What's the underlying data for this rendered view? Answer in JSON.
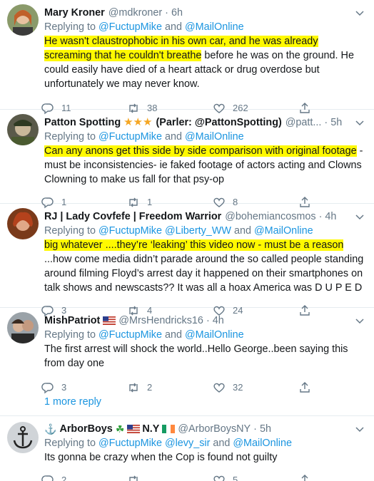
{
  "tweets": [
    {
      "name": "Mary Kroner",
      "handle": "@mdkroner",
      "time": "6h",
      "replying_prefix": "Replying to ",
      "replying_link_1": "@FuctupMike",
      "replying_and": " and ",
      "replying_link_2": "@MailOnline",
      "text_hl": "He wasn't claustrophobic in his own car, and he was already screaming that he couldn't breathe",
      "text_rest": " before he was on the ground. He could easily have died of a heart attack or drug overdose but unfortunately we may never know.",
      "replies": "11",
      "retweets": "38",
      "likes": "262"
    },
    {
      "name": "Patton Spotting",
      "name_suffix": "(Parler: @PattonSpotting)",
      "handle": "@patt...",
      "time": "5h",
      "replying_prefix": "Replying to ",
      "replying_link_1": "@FuctupMike",
      "replying_and": " and ",
      "replying_link_2": "@MailOnline",
      "text_hl": "Can any anons get this side by side comparison with original footage",
      "text_rest": " - must be inconsistencies- ie faked footage of actors acting and Clowns Clowning to make us fall for that psy-op",
      "replies": "1",
      "retweets": "1",
      "likes": "8"
    },
    {
      "name": "RJ | Lady Covfefe | Freedom Warrior",
      "handle": "@bohemiancosmos",
      "time": "4h",
      "replying_prefix": "Replying to ",
      "replying_link_1": "@FuctupMike",
      "replying_link_2": "@Liberty_WW",
      "replying_and": " and ",
      "replying_link_3": "@MailOnline",
      "text_hl": "big whatever ....they’re ‘leaking’ this video now - must be a reason",
      "text_rest": " ...how come media didn’t parade around the so called people standing around filming Floyd’s arrest day it happened on their smartphones on talk shows and newscasts??  It was all a hoax America was D U P E D",
      "replies": "3",
      "retweets": "4",
      "likes": "24"
    },
    {
      "name": "MishPatriot",
      "handle": "@MrsHendricks16",
      "time": "4h",
      "replying_prefix": "Replying to ",
      "replying_link_1": "@FuctupMike",
      "replying_and": " and ",
      "replying_link_2": "@MailOnline",
      "text": "The first arrest will shock the world..Hello George..been saying this from day one",
      "replies": "3",
      "retweets": "2",
      "likes": "32"
    },
    {
      "name_prefix": "⚓",
      "name": "ArborBoys",
      "name_mid": "☘",
      "name_tail": "N.Y",
      "handle": "@ArborBoysNY",
      "time": "5h",
      "replying_prefix": "Replying to ",
      "replying_link_1": "@FuctupMike",
      "replying_link_2": "@levy_sir",
      "replying_and": " and ",
      "replying_link_3": "@MailOnline",
      "text": "Its gonna be crazy when the Cop is found not guilty",
      "replies": "2",
      "retweets": "",
      "likes": "5"
    }
  ],
  "more_reply_label": "1 more reply",
  "separator": "·",
  "stars": "★★★",
  "colors": {
    "link": "#1b95e0",
    "highlight": "#fff900",
    "muted": "#657786"
  }
}
